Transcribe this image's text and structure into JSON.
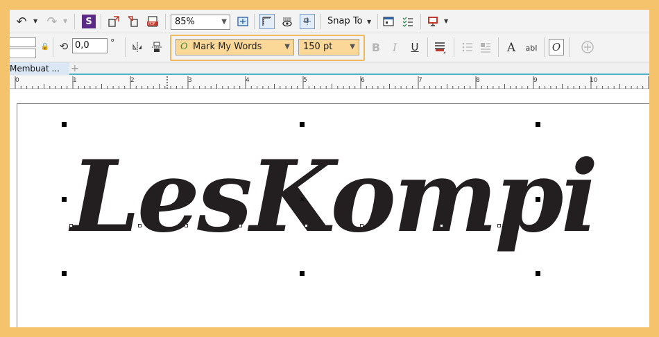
{
  "toolbar_top": {
    "zoom_value": "85%",
    "snap_label": "Snap To"
  },
  "toolbar_props": {
    "rotation_value": "0,0",
    "degree_symbol": "°",
    "font_name": "Mark My Words",
    "font_size": "150 pt"
  },
  "tabs": {
    "document_tab": "Membuat ..."
  },
  "ruler": {
    "labels": [
      "0",
      "1",
      "2",
      "3",
      "4",
      "5",
      "6",
      "7",
      "8",
      "9",
      "10"
    ]
  },
  "canvas": {
    "artistic_text": "LesKompi"
  },
  "colors": {
    "frame": "#f5c36c",
    "highlight_border": "#f2b85b",
    "field_fill": "#fbd897",
    "tab_underline": "#4fb3c8",
    "text_fill": "#231f20"
  },
  "icons": {
    "undo": "undo-icon",
    "redo": "redo-icon",
    "publish": "publish-icon",
    "import": "import-icon",
    "export": "export-icon",
    "pdf": "export-pdf-icon",
    "full_screen": "full-screen-preview-icon",
    "rulers": "show-rulers-icon",
    "wireframe": "wireframe-view-icon",
    "guidelines": "guidelines-icon",
    "options": "options-icon",
    "checklist": "checklist-icon",
    "launch": "launch-icon",
    "lock": "lock-ratio-icon",
    "rotate": "rotation-icon",
    "mirror_h": "mirror-horizontal-icon",
    "mirror_v": "mirror-vertical-icon",
    "bold": "bold-icon",
    "italic": "italic-icon",
    "underline": "underline-icon",
    "align": "text-alignment-icon",
    "bullets": "bullet-list-icon",
    "dropcap": "drop-cap-icon",
    "text_props": "text-properties-icon",
    "edit_text": "edit-text-icon",
    "opentype": "opentype-icon",
    "add": "add-icon"
  }
}
